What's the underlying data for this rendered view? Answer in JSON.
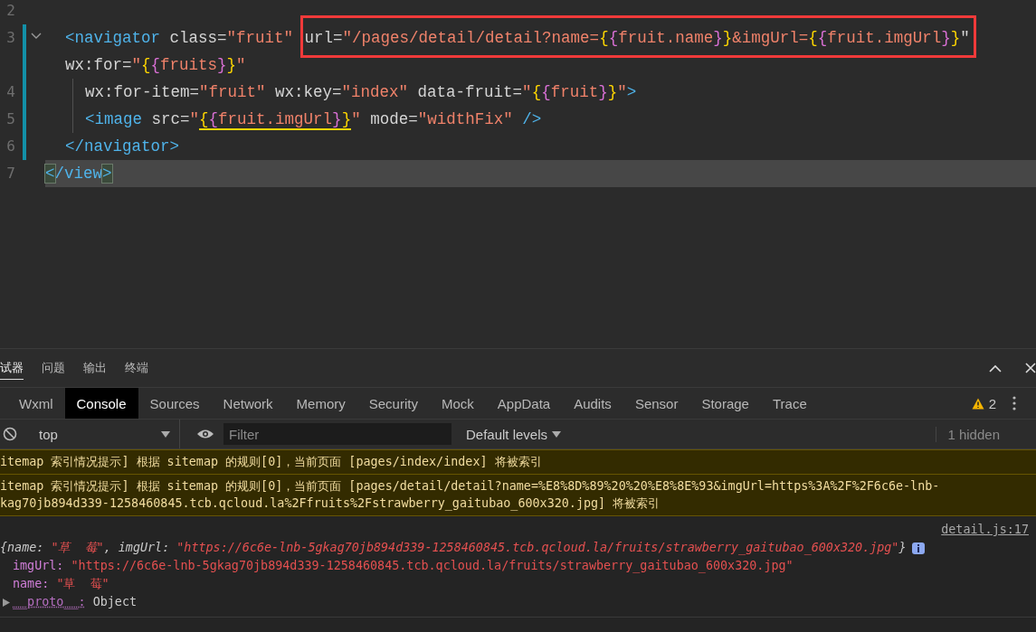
{
  "code": {
    "lines": [
      {
        "number": "2",
        "modified": false,
        "current": false
      },
      {
        "number": "3",
        "modified": true,
        "current": false,
        "expanded": true,
        "rows": [
          {
            "kind": "block",
            "parts": [
              {
                "kind": "plain",
                "tokens": [
                  {
                    "kind": "tag",
                    "text": "<navigator"
                  },
                  {
                    "kind": "attr",
                    "text": " class="
                  },
                  {
                    "kind": "string",
                    "text": "\"fruit\" "
                  }
                ]
              },
              {
                "kind": "boxed",
                "tokens": [
                  {
                    "kind": "attr",
                    "text": "url="
                  },
                  {
                    "kind": "string",
                    "text": "\"/pages/detail/detail?name="
                  },
                  {
                    "kind": "brace",
                    "text": "{"
                  },
                  {
                    "kind": "brace2",
                    "text": "{"
                  },
                  {
                    "kind": "string",
                    "text": "fruit.name"
                  },
                  {
                    "kind": "brace2",
                    "text": "}"
                  },
                  {
                    "kind": "brace",
                    "text": "}"
                  },
                  {
                    "kind": "string",
                    "text": "&imgUrl="
                  },
                  {
                    "kind": "brace",
                    "text": "{"
                  },
                  {
                    "kind": "brace2",
                    "text": "{"
                  },
                  {
                    "kind": "string",
                    "text": "fruit.imgUrl"
                  },
                  {
                    "kind": "brace2",
                    "text": "}"
                  },
                  {
                    "kind": "brace",
                    "text": "}"
                  },
                  {
                    "kind": "attr",
                    "text": "\""
                  }
                ]
              }
            ]
          },
          {
            "kind": "block",
            "parts": [
              {
                "kind": "plain",
                "tokens": [
                  {
                    "kind": "attr",
                    "text": "wx:for="
                  },
                  {
                    "kind": "string",
                    "text": "\""
                  },
                  {
                    "kind": "brace",
                    "text": "{"
                  },
                  {
                    "kind": "brace2",
                    "text": "{"
                  },
                  {
                    "kind": "string",
                    "text": "fruits"
                  },
                  {
                    "kind": "brace2",
                    "text": "}"
                  },
                  {
                    "kind": "brace",
                    "text": "}"
                  },
                  {
                    "kind": "string",
                    "text": "\""
                  }
                ]
              }
            ]
          }
        ]
      },
      {
        "number": "4",
        "modified": true,
        "current": false,
        "rows": [
          {
            "kind": "nested",
            "parts": [
              {
                "kind": "plain",
                "tokens": [
                  {
                    "kind": "attr",
                    "text": "wx:for-item="
                  },
                  {
                    "kind": "string",
                    "text": "\"fruit\""
                  },
                  {
                    "kind": "attr",
                    "text": " wx:key="
                  },
                  {
                    "kind": "string",
                    "text": "\"index\""
                  },
                  {
                    "kind": "attr",
                    "text": " data-fruit="
                  },
                  {
                    "kind": "string",
                    "text": "\""
                  },
                  {
                    "kind": "brace",
                    "text": "{"
                  },
                  {
                    "kind": "brace2",
                    "text": "{"
                  },
                  {
                    "kind": "string",
                    "text": "fruit"
                  },
                  {
                    "kind": "brace2",
                    "text": "}"
                  },
                  {
                    "kind": "brace",
                    "text": "}"
                  },
                  {
                    "kind": "string",
                    "text": "\""
                  },
                  {
                    "kind": "tag",
                    "text": ">"
                  }
                ]
              }
            ]
          }
        ]
      },
      {
        "number": "5",
        "modified": true,
        "current": false,
        "rows": [
          {
            "kind": "nested",
            "parts": [
              {
                "kind": "plain",
                "tokens": [
                  {
                    "kind": "tag",
                    "text": "<image"
                  },
                  {
                    "kind": "attr",
                    "text": " src="
                  },
                  {
                    "kind": "string",
                    "text": "\""
                  }
                ]
              },
              {
                "kind": "underlined",
                "tokens": [
                  {
                    "kind": "brace",
                    "text": "{"
                  },
                  {
                    "kind": "brace2",
                    "text": "{"
                  },
                  {
                    "kind": "string",
                    "text": "fruit.imgUrl"
                  },
                  {
                    "kind": "brace2",
                    "text": "}"
                  },
                  {
                    "kind": "brace",
                    "text": "}"
                  }
                ]
              },
              {
                "kind": "plain",
                "tokens": [
                  {
                    "kind": "string",
                    "text": "\""
                  },
                  {
                    "kind": "attr",
                    "text": " mode="
                  },
                  {
                    "kind": "string",
                    "text": "\"widthFix\" "
                  },
                  {
                    "kind": "tag",
                    "text": "/>"
                  }
                ]
              }
            ]
          }
        ]
      },
      {
        "number": "6",
        "modified": true,
        "current": false,
        "rows": [
          {
            "kind": "block",
            "parts": [
              {
                "kind": "plain",
                "tokens": [
                  {
                    "kind": "tag",
                    "text": "</navigator>"
                  }
                ]
              }
            ]
          }
        ]
      },
      {
        "number": "7",
        "modified": false,
        "current": true,
        "rows": [
          {
            "kind": "top",
            "parts": [
              {
                "kind": "matched",
                "tokens": [
                  {
                    "kind": "tag",
                    "text": "<"
                  }
                ]
              },
              {
                "kind": "plain",
                "tokens": [
                  {
                    "kind": "tag",
                    "text": "/view"
                  }
                ]
              },
              {
                "kind": "matched",
                "tokens": [
                  {
                    "kind": "tag",
                    "text": ">"
                  }
                ]
              }
            ]
          }
        ]
      }
    ]
  },
  "panel": {
    "tabs": [
      {
        "label": "试器",
        "selected": true
      },
      {
        "label": "问题",
        "selected": false
      },
      {
        "label": "输出",
        "selected": false
      },
      {
        "label": "终端",
        "selected": false
      }
    ],
    "devtools_tabs": [
      {
        "label": "Wxml",
        "selected": false
      },
      {
        "label": "Console",
        "selected": true
      },
      {
        "label": "Sources",
        "selected": false
      },
      {
        "label": "Network",
        "selected": false
      },
      {
        "label": "Memory",
        "selected": false
      },
      {
        "label": "Security",
        "selected": false
      },
      {
        "label": "Mock",
        "selected": false
      },
      {
        "label": "AppData",
        "selected": false
      },
      {
        "label": "Audits",
        "selected": false
      },
      {
        "label": "Sensor",
        "selected": false
      },
      {
        "label": "Storage",
        "selected": false
      },
      {
        "label": "Trace",
        "selected": false
      }
    ],
    "warning_count": "2",
    "context": "top",
    "filter": {
      "placeholder": "Filter"
    },
    "levels": "Default levels",
    "hidden": "1 hidden",
    "messages": [
      {
        "kind": "warning",
        "lines": [
          "itemap 索引情况提示] 根据 sitemap 的规则[0]，当前页面 [pages/index/index] 将被索引"
        ]
      },
      {
        "kind": "warning",
        "lines": [
          "itemap 索引情况提示] 根据 sitemap 的规则[0]，当前页面 [pages/detail/detail?name=%E8%8D%89%20%20%E8%8E%93&imgUrl=https%3A%2F%2F6c6e-lnb-",
          "kag70jb894d339-1258460845.tcb.qcloud.la%2Ffruits%2Fstrawberry_gaitubao_600x320.jpg] 将被索引"
        ]
      },
      {
        "kind": "log",
        "source": "detail.js:17",
        "summary": [
          {
            "kind": "punct",
            "text": "{"
          },
          {
            "kind": "key",
            "text": "name"
          },
          {
            "kind": "punct",
            "text": ": "
          },
          {
            "kind": "string",
            "text": "\"草  莓\""
          },
          {
            "kind": "punct",
            "text": ", "
          },
          {
            "kind": "key",
            "text": "imgUrl"
          },
          {
            "kind": "punct",
            "text": ": "
          },
          {
            "kind": "string",
            "text": "\"https://6c6e-lnb-5gkag70jb894d339-1258460845.tcb.qcloud.la/fruits/strawberry_gaitubao_600x320.jpg\""
          },
          {
            "kind": "punct",
            "text": "}"
          }
        ],
        "properties": [
          {
            "key": "imgUrl:",
            "value": "\"https://6c6e-lnb-5gkag70jb894d339-1258460845.tcb.qcloud.la/fruits/strawberry_gaitubao_600x320.jpg\"",
            "kind": "string"
          },
          {
            "key": "name:",
            "value": "\"草  莓\"",
            "kind": "string"
          },
          {
            "key": "__proto__:",
            "value": "Object",
            "kind": "object"
          }
        ]
      }
    ]
  }
}
